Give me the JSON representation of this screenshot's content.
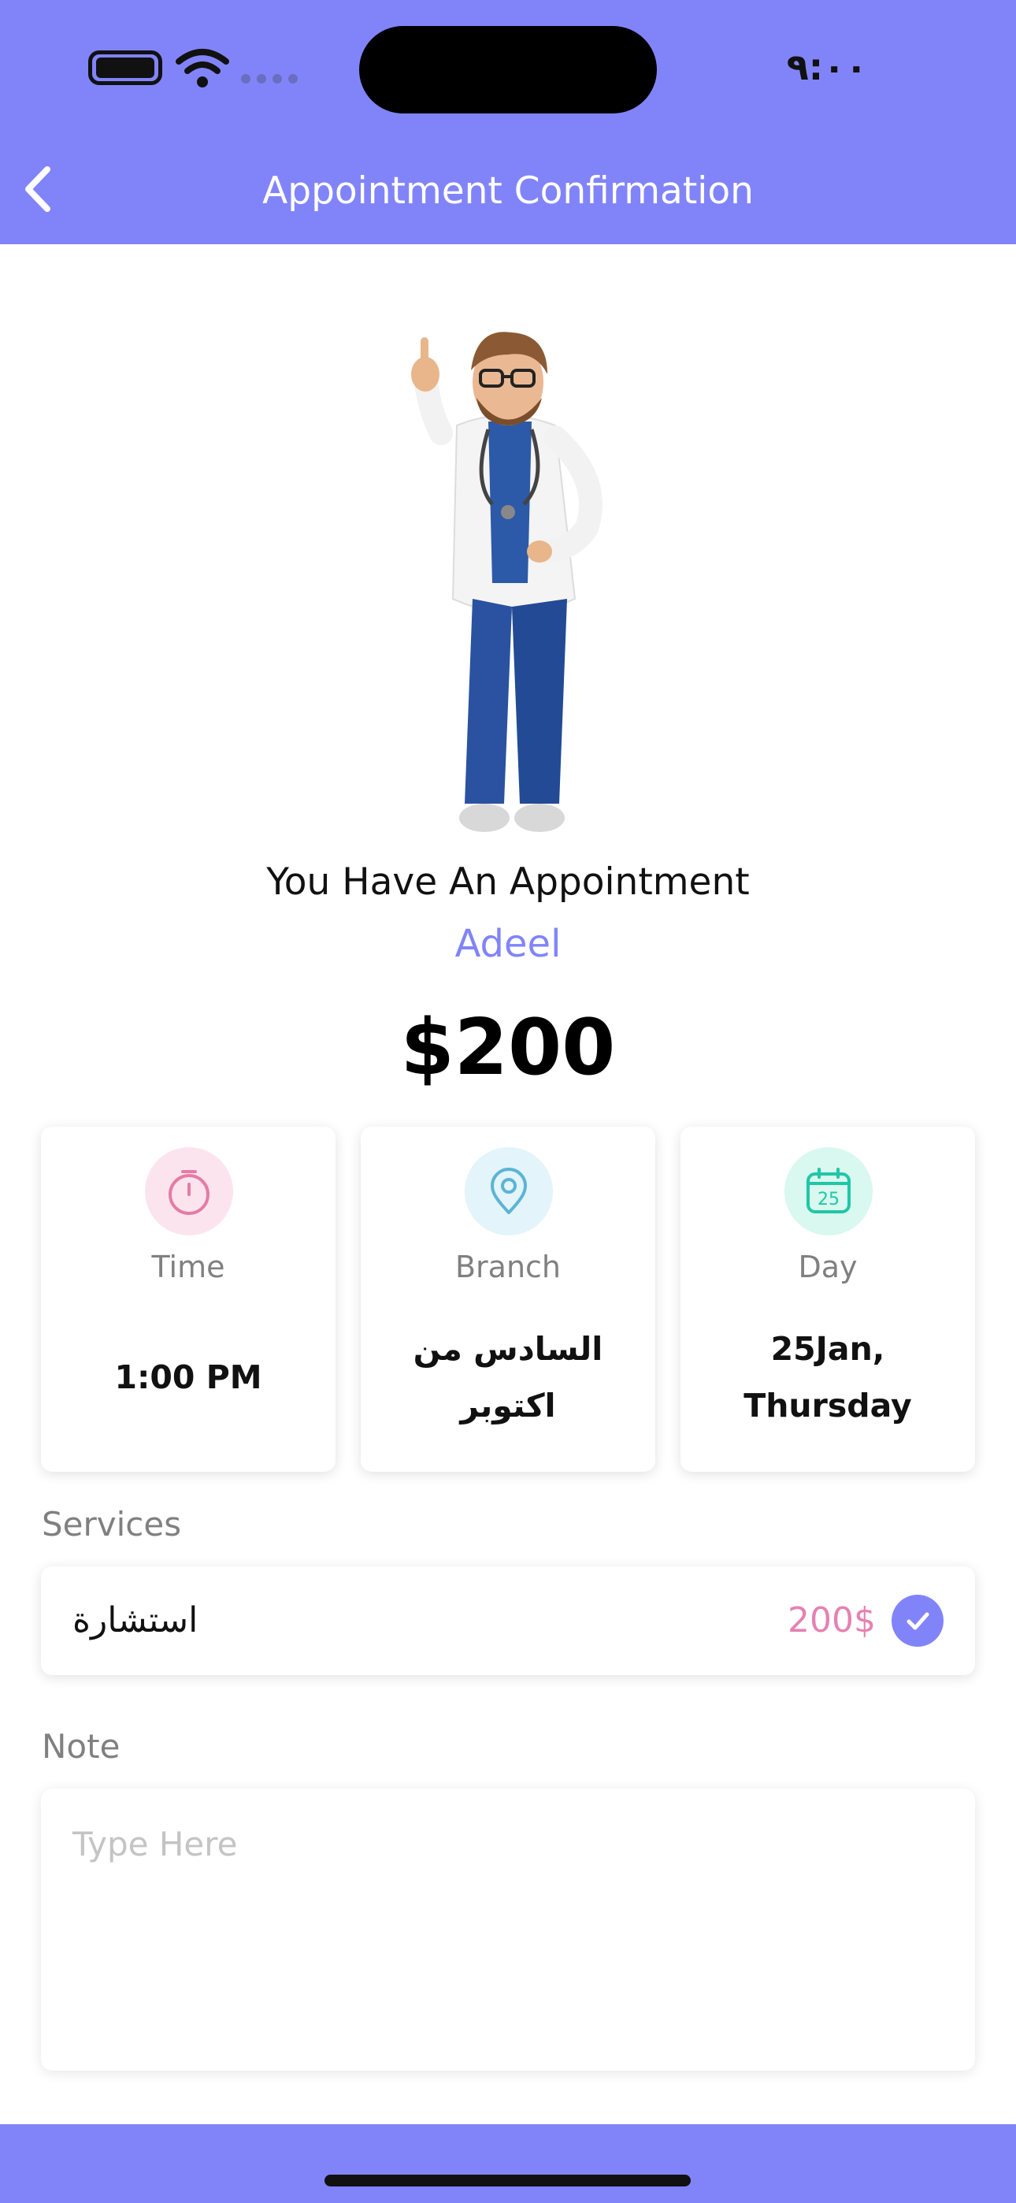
{
  "status_bar": {
    "time": "٩:٠٠"
  },
  "nav": {
    "title": "Appointment Confirmation"
  },
  "appointment": {
    "heading": "You Have An Appointment",
    "doctor_name": "Adeel",
    "price": "$200"
  },
  "cards": {
    "time": {
      "label": "Time",
      "value": "1:00 PM",
      "icon": "timer-icon"
    },
    "branch": {
      "label": "Branch",
      "value": "السادس من اكتوبر",
      "icon": "location-pin-icon"
    },
    "day": {
      "label": "Day",
      "value": "25Jan, Thursday",
      "icon": "calendar-icon",
      "icon_number": "25"
    }
  },
  "services": {
    "label": "Services",
    "items": [
      {
        "name": "استشارة",
        "price": "200$",
        "selected": true
      }
    ]
  },
  "note": {
    "label": "Note",
    "placeholder": "Type Here"
  },
  "colors": {
    "primary": "#8184F9",
    "service_price": "#E582B1",
    "time_icon": "#E57BA6",
    "branch_icon": "#5BB4D6",
    "day_icon": "#1FC7A6"
  }
}
